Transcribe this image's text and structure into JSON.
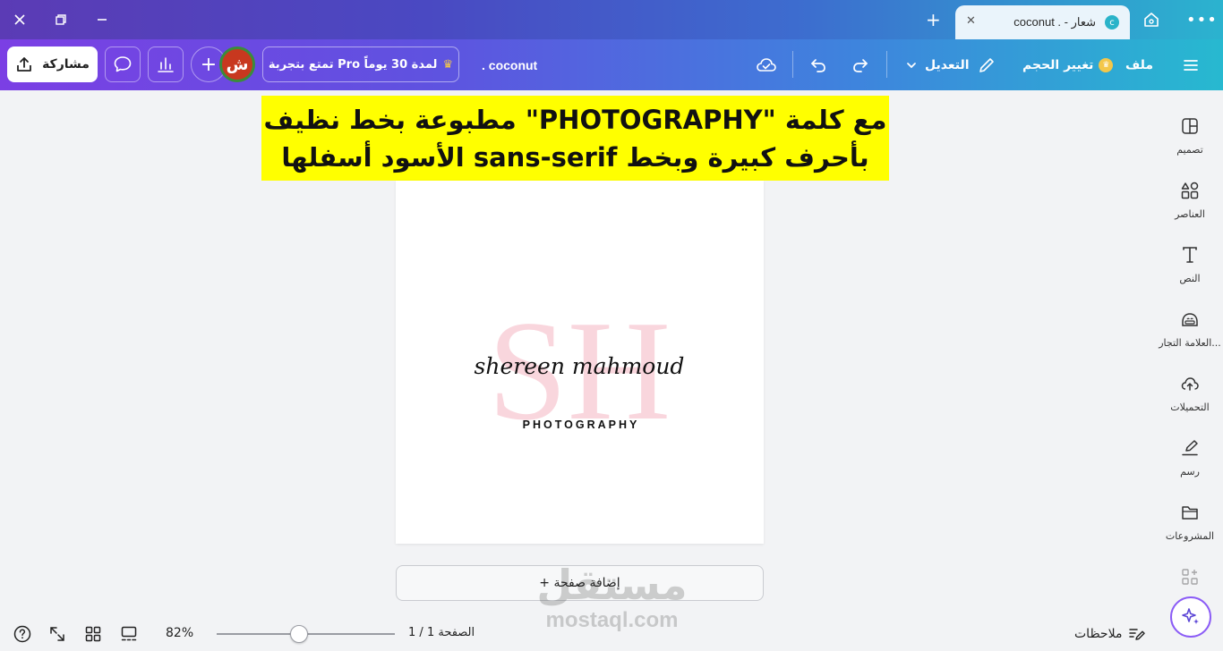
{
  "window": {
    "tab_title": "coconut . - شعار",
    "tab_logo": "c"
  },
  "toolbar": {
    "menu_icon": "hamburger-icon",
    "file_label": "ملف",
    "resize_label": "تغيير الحجم",
    "edit_label": "التعديل",
    "doc_title": ". coconut",
    "pro_trial_label": "تمتع بتجربة Pro لمدة 30 يوماً",
    "avatar_initials": "ش",
    "share_label": "مشاركة"
  },
  "annotation": {
    "line1": "مع كلمة \"PHOTOGRAPHY\" مطبوعة بخط نظيف",
    "line2": "بأحرف كبيرة وبخط sans-serif الأسود أسفلها"
  },
  "design": {
    "monogram": "SH",
    "signature": "shereen mahmoud",
    "tagline": "PHOTOGRAPHY",
    "monogram_color": "#f9d6dd"
  },
  "canvas": {
    "add_page_label": "+ إضافة صفحة"
  },
  "watermark": {
    "arabic": "مستقل",
    "latin": "mostaql.com"
  },
  "sidebar": {
    "items": [
      {
        "label": "تصميم",
        "icon": "layout-icon"
      },
      {
        "label": "العناصر",
        "icon": "shapes-icon"
      },
      {
        "label": "النص",
        "icon": "text-icon"
      },
      {
        "label": "العلامة التجار...",
        "icon": "brand-icon"
      },
      {
        "label": "التحميلات",
        "icon": "upload-cloud-icon"
      },
      {
        "label": "رسم",
        "icon": "draw-icon"
      },
      {
        "label": "المشروعات",
        "icon": "folder-icon"
      }
    ]
  },
  "bottom": {
    "notes_label": "ملاحظات",
    "page_counter": "الصفحة 1 / 1",
    "zoom": "82%",
    "zoom_value": 82
  },
  "colors": {
    "brand_purple": "#7b3fe4",
    "brand_teal": "#27b9d0",
    "highlight_yellow": "#ffff00"
  }
}
